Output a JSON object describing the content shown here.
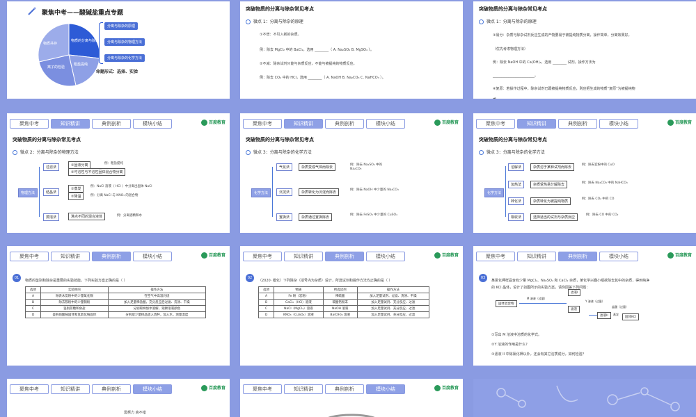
{
  "tabs": [
    "聚焦中考",
    "知识精讲",
    "典例剖析",
    "模块小结"
  ],
  "logo": "百度教育",
  "s1": {
    "title": "聚焦中考——酸碱盐重点专题",
    "pie": [
      "物质的分离与除杂",
      "物质共存",
      "离子的检验",
      "粗盐提纯"
    ],
    "items": [
      "分离与除杂的原理",
      "分离与除杂的物理方法",
      "分离与除杂的化学方法"
    ],
    "form": "命题形式：选择、实验"
  },
  "s2": {
    "title": "突破物质的分离与除杂常见考点",
    "pt": "微点 1：分离与除杂的原理",
    "l1": "①不增：不引入新的杂质。",
    "l2": "例：除去 MgCl₂ 中的 BaCl₂，选用 ________（ A. Na₂SO₄   B. MgSO₄ ）。",
    "l3": "②不减：除杂试剂只能与杂质反应，不能与被提纯的物质反应。",
    "l4": "例：除去 CO₂ 中的 HCl，选用 ________（ A. NaOH     B. Na₂CO₃     C. NaHCO₃ ）。"
  },
  "s3": {
    "title": "突破物质的分离与除杂常见考点",
    "pt": "微点 1：分离与除杂的原理",
    "l1": "③易分：杂质与除杂试剂反应生成的产物要易于被提纯物质分离，操作简单，分离效果好。",
    "l2": "（优先考虑物理方法）",
    "l3": "例：除去 NaOH 中的 Ca(OH)₂，选用 ________ 试剂，操作方法为",
    "l4": "________________________。",
    "l5": "④复原：若操作过程中，除杂试剂已跟被提纯物质反应，则应把生成的物质“复原”为被提纯物",
    "l6": "质。"
  },
  "s4": {
    "title": "突破物质的分离与除杂常见考点",
    "pt": "微点 2：分离与除杂的物理方法",
    "root": "物理方法",
    "m1": "过滤法",
    "m2": "结晶法",
    "m3": "蒸馏法",
    "b1": "①固液分离",
    "b2": "②可溶性与不溶性固体混合物分离",
    "n1": "例：粗盐提纯",
    "b3": "①蒸发",
    "b4": "②降温",
    "n2": "例：NaCl 溶液（ HCl ）中分离出固体 NaCl",
    "n3": "例：分离 NaCl 与 KNO₃ 的混合物",
    "b5": "沸点不同的混合液体",
    "n4": "例：分离酒精和水"
  },
  "s5": {
    "title": "突破物质的分离与除杂常见考点",
    "pt": "微点 3：分离与除杂的化学方法",
    "root": "化学方法",
    "m1": "气化法",
    "m2": "沉淀法",
    "m3": "置换法",
    "b1": "杂质变成气体而除去",
    "n1": "例：除去 Na₂SO₄ 中的 Na₂CO₃",
    "b2": "杂质转化为沉淀而除去",
    "n2": "例：除去 NaOH 中少量的 Na₂CO₃",
    "b3": "杂质通过置换除去",
    "n3": "例：除去 FeSO₄ 中少量的 CuSO₄"
  },
  "s6": {
    "title": "突破物质的分离与除杂常见考点",
    "pt": "微点 3：分离与除杂的化学方法",
    "root": "化学方法",
    "m1": "溶解法",
    "m2": "加热法",
    "m3": "转化法",
    "m4": "吸收法",
    "b1": "杂质溶于某种试剂而除去",
    "n1": "例：除去炭粉中的 CuO",
    "b2": "杂质受热易分解除去",
    "n2": "例：除去 Na₂CO₃ 中的 NaHCO₃",
    "b3": "杂质转化为被提纯物质",
    "n3": "例：除去 CO₂ 中的 CO",
    "b4": "选择适当的试剂与杂质反应",
    "n4": "例：除去 CO 中的 CO₂"
  },
  "s7": {
    "q": "01",
    "text": "物质的鉴别和除杂是重要的实验技能。下列实验方案正确的是（      ）",
    "head": [
      "选项",
      "实验目的",
      "操作方法"
    ],
    "rows": [
      [
        "A",
        "除去木炭粉中的少量氧化铜",
        "在空气中高温灼烧"
      ],
      [
        "B",
        "除去铁粉中的少量铜粉",
        "加入足量稀盐酸，充分反应后过滤、洗涤、干燥"
      ],
      [
        "C",
        "鉴别蔗糖和食盐",
        "分别取样加水溶解，观察溶液颜色"
      ],
      [
        "D",
        "鉴别硝酸铵固体和氢氧化钠固体",
        "分别取少量样品放入烧杯，加入水，测量温度"
      ]
    ]
  },
  "s8": {
    "q": "02",
    "text": "（2020· 模化）下列除杂（括号内为杂质）设计，所选试剂和操作方法均正确的是（      ）",
    "head": [
      "选项",
      "物质",
      "所选试剂",
      "操作方法"
    ],
    "rows": [
      [
        "A",
        "Fe 粉（炭粉）",
        "稀硫酸",
        "加入足量试剂、过滤、洗涤、干燥"
      ],
      [
        "B",
        "CaCl₂（HCl）溶液",
        "碳酸钙粉末",
        "加入足量试剂、充分反应、过滤"
      ],
      [
        "C",
        "NaCl（MgCl₂）溶液",
        "NaOH 溶液",
        "加入足量试剂、充分反应、过滤"
      ],
      [
        "D",
        "KNO₃（CuSO₄）溶液",
        "Ba(OH)₂ 溶液",
        "加入足量试剂、充分反应、过滤"
      ]
    ]
  },
  "s9": {
    "q": "03",
    "text": "某氯化钾样品含有少量 MgCl₂、Na₂SO₄ 和 CaCl₂ 杂质，某化学兴趣小组欲除去其中的杂质，得到纯净",
    "text2": "的 KCl 晶体，设计了如图所示的实验方案，请你回答下列问题：",
    "flow": [
      "固体混合物",
      "M 溶液（过量）",
      "Y 溶液（过量）",
      "盐酸（过量）",
      "蒸发",
      "固体KCl",
      "滤液I",
      "滤液II",
      "滤渣"
    ],
    "q1": "①写出 M 溶液中溶质的化学式。",
    "q2": "②Y 溶液的作用是什么？",
    "q3": "③滤液 II 中除氯化钾以外，还会有其它溶质成分，如何检验？"
  },
  "s10": {
    "text": "需努力   真不错"
  }
}
